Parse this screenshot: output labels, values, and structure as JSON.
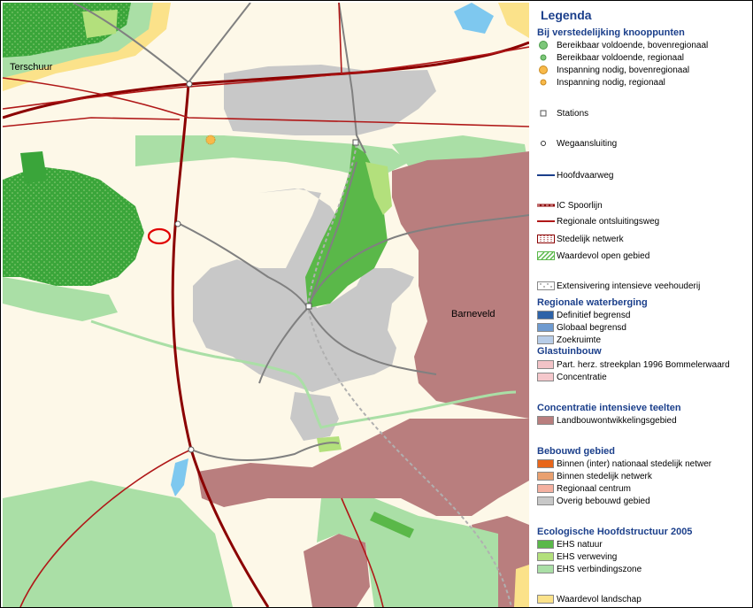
{
  "map": {
    "places": {
      "terschuur": "Terschuur",
      "barneveld": "Barneveld"
    },
    "colors": {
      "background": "#fdf8e8",
      "urban": "#c8c8c8",
      "glastuinbouw": "#b97e7e",
      "ehs_natuur": "#5ab849",
      "ehs_verweving": "#b3e07c",
      "ehs_verbindingszone": "#aadfa6",
      "forest_dark": "#3aa53a",
      "landschap": "#fbe28a",
      "water": "#7ec8ef",
      "ic_spoor": "#8b0000",
      "regionale_weg": "#b01818",
      "marker": "#e00000"
    }
  },
  "legend": {
    "title": "Legenda",
    "sections": [
      {
        "title": "Bij verstedelijking knooppunten",
        "items": [
          {
            "icon": "green-dot-large-icon",
            "label": "Bereikbaar voldoende, bovenregionaal"
          },
          {
            "icon": "green-dot-small-icon",
            "label": "Bereikbaar voldoende, regionaal"
          },
          {
            "icon": "orange-dot-large-icon",
            "label": "Inspanning nodig, bovenregionaal"
          },
          {
            "icon": "orange-dot-small-icon",
            "label": "Inspanning nodig, regionaal"
          },
          {
            "icon": "station-square-icon",
            "label": "Stations"
          },
          {
            "icon": "junction-circle-icon",
            "label": "Wegaansluiting"
          },
          {
            "icon": "waterway-line-icon",
            "label": "Hoofdvaarweg"
          },
          {
            "icon": "ic-rail-line-icon",
            "label": "IC Spoorlijn"
          },
          {
            "icon": "regional-road-line-icon",
            "label": "Regionale ontsluitingsweg"
          },
          {
            "icon": "urban-network-hatch-icon",
            "label": "Stedelijk netwerk"
          },
          {
            "icon": "open-area-hatch-icon",
            "label": "Waardevol open gebied"
          },
          {
            "icon": "livestock-dots-icon",
            "label": "Extensivering intensieve veehouderij"
          }
        ]
      },
      {
        "title": "Regionale waterberging",
        "items": [
          {
            "color": "#2e63a8",
            "label": "Definitief begrensd"
          },
          {
            "color": "#6f9bd0",
            "label": "Globaal begrensd"
          },
          {
            "color": "#b8cde8",
            "label": "Zoekruimte"
          }
        ]
      },
      {
        "title": "Glastuinbouw",
        "items": [
          {
            "color": "#f2c3c7",
            "label": "Part. herz. streekplan 1996 Bommelerwaard"
          },
          {
            "color": "#f5c8cc",
            "label": "Concentratie"
          }
        ]
      },
      {
        "title": "Concentratie intensieve teelten",
        "items": [
          {
            "color": "#b97e7e",
            "label": "Landbouwontwikkelingsgebied"
          }
        ]
      },
      {
        "title": "Bebouwd gebied",
        "items": [
          {
            "color": "#e8661a",
            "label": "Binnen (inter) nationaal stedelijk netwer"
          },
          {
            "color": "#e9a070",
            "label": "Binnen stedelijk netwerk"
          },
          {
            "color": "#f4b0a0",
            "label": "Regionaal centrum"
          },
          {
            "color": "#c8c8c8",
            "label": "Overig bebouwd gebied"
          }
        ]
      },
      {
        "title": "Ecologische Hoofdstructuur 2005",
        "items": [
          {
            "color": "#5ab849",
            "label": "EHS natuur"
          },
          {
            "color": "#b3e07c",
            "label": "EHS verweving"
          },
          {
            "color": "#aadfa6",
            "label": "EHS verbindingszone"
          }
        ]
      },
      {
        "title": "",
        "items": [
          {
            "color": "#fbe28a",
            "label": "Waardevol landschap"
          }
        ]
      }
    ]
  }
}
